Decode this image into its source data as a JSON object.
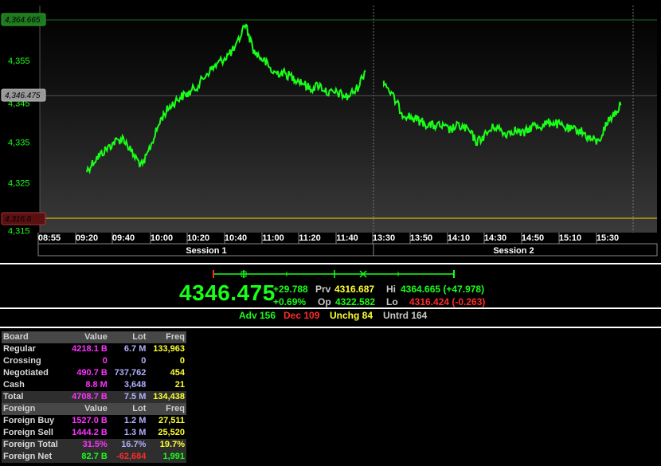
{
  "chart_data": {
    "type": "line",
    "ylim": [
      4315,
      4365
    ],
    "yticks": [
      "4,325",
      "4,335",
      "4,355"
    ],
    "partial_tick_top": "4,345",
    "partial_tick_bottom": "4,315",
    "x_tick_labels": [
      "08:55",
      "09:20",
      "09:40",
      "10:00",
      "10:20",
      "10:40",
      "11:00",
      "11:20",
      "11:40",
      "13:30",
      "13:50",
      "14:10",
      "14:30",
      "14:50",
      "15:10",
      "15:30"
    ],
    "sessions": [
      "Session 1",
      "Session 2"
    ],
    "high_tag": "4,364.665",
    "current_tag": "4,346.475",
    "prev_tag": "4,316.6",
    "series": [
      {
        "color": "#19ff19",
        "x": [
          "09:20",
          "09:25",
          "09:30",
          "09:35",
          "09:40",
          "09:45",
          "09:50",
          "09:55",
          "10:00",
          "10:05",
          "10:10",
          "10:15",
          "10:20",
          "10:25",
          "10:30",
          "10:35",
          "10:40",
          "10:45",
          "10:50",
          "10:55",
          "11:00",
          "11:05",
          "11:10",
          "11:15",
          "11:20",
          "11:25",
          "11:30",
          "11:35",
          "11:40",
          "11:45",
          "11:50",
          "13:30",
          "13:35",
          "13:40",
          "13:45",
          "13:50",
          "13:55",
          "14:00",
          "14:05",
          "14:10",
          "14:15",
          "14:20",
          "14:25",
          "14:30",
          "14:35",
          "14:40",
          "14:45",
          "14:50",
          "14:55",
          "15:00",
          "15:05",
          "15:10",
          "15:15",
          "15:20",
          "15:25",
          "15:30",
          "15:35"
        ],
        "y": [
          4328,
          4331,
          4333,
          4335,
          4336,
          4332,
          4329,
          4335,
          4341,
          4344,
          4346,
          4347,
          4349,
          4352,
          4354,
          4356,
          4358,
          4364,
          4357,
          4355,
          4352,
          4352,
          4351,
          4350,
          4348,
          4349,
          4347,
          4347,
          4346,
          4348,
          4353,
          4350,
          4346,
          4342,
          4341,
          4340,
          4339,
          4339,
          4338,
          4339,
          4338,
          4335,
          4337,
          4339,
          4337,
          4338,
          4337,
          4339,
          4339,
          4340,
          4339,
          4338,
          4338,
          4336,
          4335,
          4340,
          4344
        ]
      }
    ]
  },
  "indicator": {
    "last": "4346.475",
    "change": "+29.788",
    "change_pct": "+0.69%",
    "prv_label": "Prv",
    "prv_value": "4316.687",
    "op_label": "Op",
    "op_value": "4322.582",
    "hi_label": "Hi",
    "hi_value": "4364.665 (+47.978)",
    "lo_label": "Lo",
    "lo_value": "4316.424 (-0.263)"
  },
  "breadth": {
    "adv": "Adv 156",
    "dec": "Dec 109",
    "unchg": "Unchg 84",
    "untrd": "Untrd 164"
  },
  "board": {
    "headers": [
      "Board",
      "Value",
      "Lot",
      "Freq"
    ],
    "rows": [
      {
        "name": "Regular",
        "value": "4218.1 B",
        "lot": "6.7 M",
        "freq": "133,963"
      },
      {
        "name": "Crossing",
        "value": "0",
        "lot": "0",
        "freq": "0"
      },
      {
        "name": "Negotiated",
        "value": "490.7 B",
        "lot": "737,762",
        "freq": "454"
      },
      {
        "name": "Cash",
        "value": "8.8 M",
        "lot": "3,648",
        "freq": "21"
      }
    ],
    "total": {
      "name": "Total",
      "value": "4708.7 B",
      "lot": "7.5 M",
      "freq": "134,438"
    }
  },
  "foreign": {
    "headers": [
      "Foreign",
      "Value",
      "Lot",
      "Freq"
    ],
    "rows": [
      {
        "name": "Foreign Buy",
        "value": "1527.0 B",
        "lot": "1.2 M",
        "freq": "27,511"
      },
      {
        "name": "Foreign Sell",
        "value": "1444.2 B",
        "lot": "1.3 M",
        "freq": "25,520"
      }
    ],
    "total": {
      "name": "Foreign Total",
      "value": "31.5%",
      "lot": "16.7%",
      "freq": "19.7%"
    },
    "net": {
      "name": "Foreign Net",
      "value": "82.7 B",
      "lot": "-62,684",
      "freq": "1,991"
    }
  },
  "colors": {
    "line": "#19ff19",
    "prev_line": "#ffd700",
    "high_line": "#1f6a1f",
    "up": "#19ff19",
    "down": "#ff2b2b",
    "highlight": "#ffff33",
    "value": "#ff33ff",
    "lot": "#b0b0ff"
  }
}
